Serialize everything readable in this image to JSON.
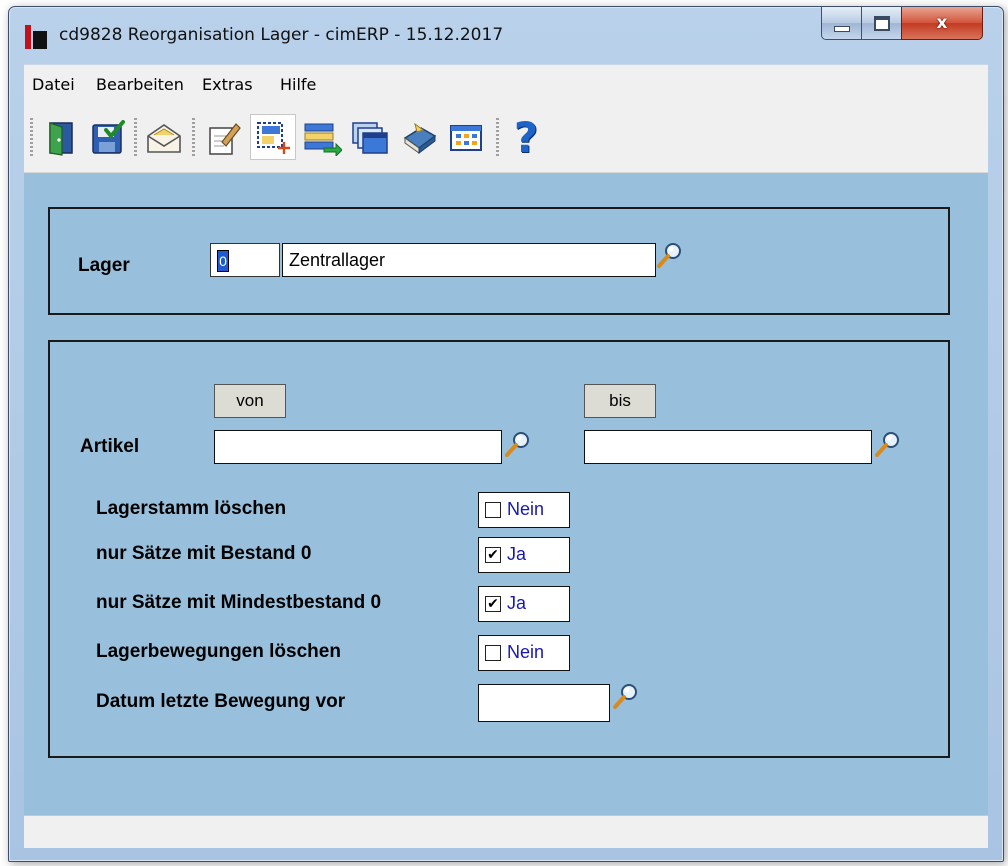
{
  "window": {
    "title": "cd9828 Reorganisation Lager - cimERP - 15.12.2017",
    "close_glyph": "x"
  },
  "menu": {
    "items": [
      "Datei",
      "Bearbeiten",
      "Extras",
      "Hilfe"
    ]
  },
  "toolbar": {
    "icons": [
      "exit-door-icon",
      "save-icon",
      "mail-icon",
      "edit-icon",
      "new-record-icon",
      "list-transfer-icon",
      "windows-icon",
      "book-icon",
      "grid-icon",
      "help-icon"
    ],
    "help_glyph": "?"
  },
  "lager": {
    "label": "Lager",
    "code": "0",
    "name": "Zentrallager"
  },
  "range": {
    "von_label": "von",
    "bis_label": "bis",
    "artikel_label": "Artikel",
    "artikel_von": "",
    "artikel_bis": ""
  },
  "options": [
    {
      "label": "Lagerstamm löschen",
      "checked": false,
      "value": "Nein"
    },
    {
      "label": "nur Sätze mit Bestand 0",
      "checked": true,
      "value": "Ja"
    },
    {
      "label": "nur Sätze mit Mindestbestand 0",
      "checked": true,
      "value": "Ja"
    },
    {
      "label": "Lagerbewegungen löschen",
      "checked": false,
      "value": "Nein"
    }
  ],
  "datum": {
    "label": "Datum letzte Bewegung vor",
    "value": ""
  },
  "colors": {
    "content_bg": "#98c0dc",
    "checkbox_text": "#1717b8",
    "close_button": "#c23b22"
  }
}
